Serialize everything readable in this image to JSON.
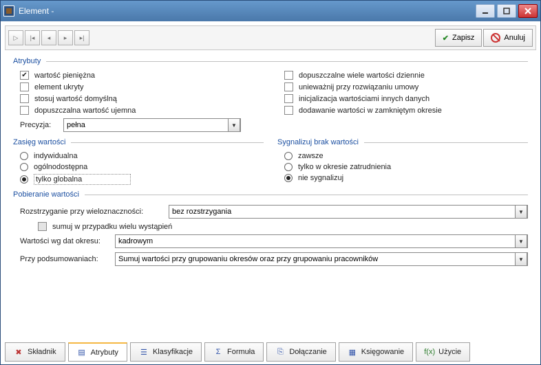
{
  "window": {
    "title": "Element -"
  },
  "toolbar": {
    "save_label": "Zapisz",
    "cancel_label": "Anuluj"
  },
  "groups": {
    "attributes": {
      "title": "Atrybuty",
      "left": [
        {
          "label": "wartość pieniężna",
          "checked": true
        },
        {
          "label": "element ukryty",
          "checked": false
        },
        {
          "label": "stosuj wartość domyślną",
          "checked": false
        },
        {
          "label": "dopuszczalna wartość ujemna",
          "checked": false
        }
      ],
      "right": [
        {
          "label": "dopuszczalne wiele wartości dziennie",
          "checked": false
        },
        {
          "label": "unieważnij przy rozwiązaniu umowy",
          "checked": false
        },
        {
          "label": "inicjalizacja wartościami innych danych",
          "checked": false
        },
        {
          "label": "dodawanie wartości w zamkniętym okresie",
          "checked": false
        }
      ],
      "precision_label": "Precyzja:",
      "precision_value": "pełna"
    },
    "scope": {
      "title": "Zasięg wartości",
      "options": [
        {
          "label": "indywidualna",
          "selected": false
        },
        {
          "label": "ogólnodostępna",
          "selected": false
        },
        {
          "label": "tylko globalna",
          "selected": true
        }
      ]
    },
    "signal": {
      "title": "Sygnalizuj brak wartości",
      "options": [
        {
          "label": "zawsze",
          "selected": false
        },
        {
          "label": "tylko w okresie zatrudnienia",
          "selected": false
        },
        {
          "label": "nie sygnalizuj",
          "selected": true
        }
      ]
    },
    "retrieval": {
      "title": "Pobieranie wartości",
      "ambiguity_label": "Rozstrzyganie przy wieloznaczności:",
      "ambiguity_value": "bez rozstrzygania",
      "sum_label": "sumuj w przypadku wielu wystąpień",
      "sum_checked": false,
      "values_by_label": "Wartości wg dat okresu:",
      "values_by_value": "kadrowym",
      "summary_label": "Przy podsumowaniach:",
      "summary_value": "Sumuj wartości przy grupowaniu okresów oraz przy grupowaniu pracowników"
    }
  },
  "tabs": [
    {
      "label": "Składnik",
      "icon": "component"
    },
    {
      "label": "Atrybuty",
      "icon": "attributes",
      "active": true
    },
    {
      "label": "Klasyfikacje",
      "icon": "classifications"
    },
    {
      "label": "Formuła",
      "icon": "formula"
    },
    {
      "label": "Dołączanie",
      "icon": "attach"
    },
    {
      "label": "Księgowanie",
      "icon": "accounting"
    },
    {
      "label": "Użycie",
      "icon": "usage"
    }
  ]
}
